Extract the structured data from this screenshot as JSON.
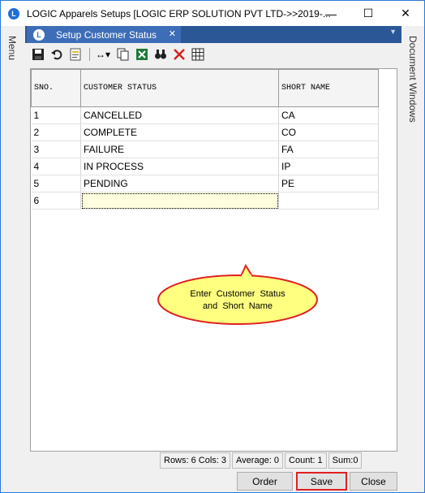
{
  "window": {
    "title": "LOGIC Apparels Setups  [LOGIC ERP SOLUTION PVT LTD->>2019-...",
    "minimize_glyph": "—",
    "maximize_glyph": "☐",
    "close_glyph": "✕"
  },
  "side": {
    "left_label": "Menu",
    "right_label": "Document Windows"
  },
  "tab": {
    "label": "Setup Customer Status",
    "close_glyph": "✕",
    "overflow_glyph": "▼"
  },
  "toolbar": {
    "icons": [
      "save-icon",
      "undo-icon",
      "notes-icon",
      "column-width-icon",
      "copy-icon",
      "excel-icon",
      "find-icon",
      "delete-icon",
      "grid-icon"
    ]
  },
  "grid": {
    "columns": [
      "SNO.",
      "CUSTOMER STATUS",
      "SHORT NAME"
    ],
    "rows": [
      {
        "sno": "1",
        "status": "CANCELLED",
        "short": "CA"
      },
      {
        "sno": "2",
        "status": "COMPLETE",
        "short": "CO"
      },
      {
        "sno": "3",
        "status": "FAILURE",
        "short": "FA"
      },
      {
        "sno": "4",
        "status": "IN PROCESS",
        "short": "IP"
      },
      {
        "sno": "5",
        "status": "PENDING",
        "short": "PE"
      },
      {
        "sno": "6",
        "status": "",
        "short": ""
      }
    ]
  },
  "callout": {
    "line1": "Enter Customer Status",
    "line2": "and Short Name"
  },
  "status": {
    "rows": "Rows: 6  Cols: 3",
    "average": "Average: 0",
    "count": "Count: 1",
    "sum": "Sum:0"
  },
  "buttons": {
    "order": "Order",
    "save": "Save",
    "close": "Close"
  },
  "colors": {
    "tabstrip": "#2b5797",
    "highlight_border": "#e02020",
    "callout_fill": "#ffff80",
    "callout_border": "#e02020"
  }
}
